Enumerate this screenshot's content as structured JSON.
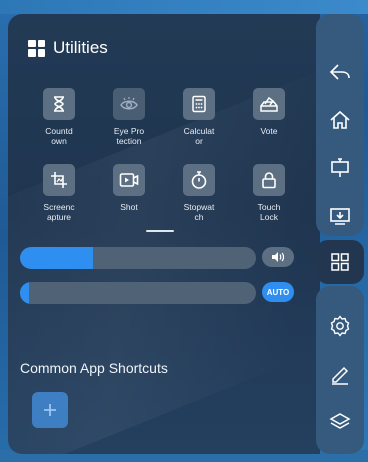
{
  "header": {
    "title": "Utilities",
    "icon": "grid-icon"
  },
  "tools": [
    {
      "label": "Countd\nown",
      "icon": "hourglass-icon"
    },
    {
      "label": "Eye Pro\ntection",
      "icon": "eye-protection-icon"
    },
    {
      "label": "Calculat\nor",
      "icon": "calculator-icon"
    },
    {
      "label": "Vote",
      "icon": "vote-icon"
    },
    {
      "label": "Screenc\napture",
      "icon": "screencapture-icon"
    },
    {
      "label": "Shot",
      "icon": "shot-icon"
    },
    {
      "label": "Stopwat\nch",
      "icon": "stopwatch-icon"
    },
    {
      "label": "Touch\nLock",
      "icon": "lock-icon"
    }
  ],
  "volume": {
    "level": 0.31,
    "icon": "speaker-icon"
  },
  "brightness": {
    "level": 0.04,
    "auto_label": "AUTO"
  },
  "shortcuts": {
    "title": "Common App Shortcuts",
    "add_icon": "plus-icon"
  },
  "rail": [
    {
      "icon": "back-icon"
    },
    {
      "icon": "home-icon"
    },
    {
      "icon": "whiteboard-icon"
    },
    {
      "icon": "screen-cast-icon"
    },
    {
      "icon": "apps-grid-icon"
    },
    {
      "icon": "settings-icon"
    },
    {
      "icon": "pen-icon"
    },
    {
      "icon": "layers-icon"
    }
  ],
  "colors": {
    "accent": "#2f8ff0",
    "panel": "#223a55",
    "rail": "#365a7d"
  }
}
